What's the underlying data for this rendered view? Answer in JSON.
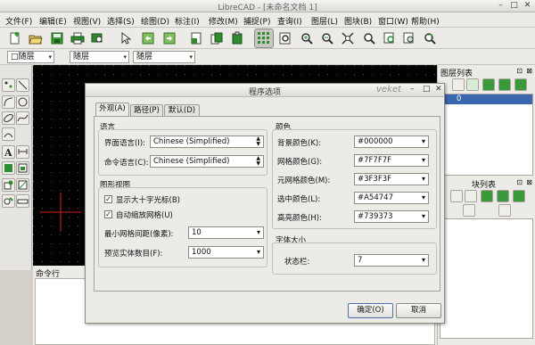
{
  "window": {
    "title": "LibreCAD - [未命名文档 1]"
  },
  "menus": [
    "文件(F)",
    "编辑(E)",
    "视图(V)",
    "选择(S)",
    "绘图(D)",
    "标注(I)",
    "修改(M)",
    "捕捉(P)",
    "查询(I)",
    "图层(L)",
    "图块(B)",
    "窗口(W)",
    "帮助(H)"
  ],
  "layerbar": {
    "combo1": "□随层",
    "combo2": "随层",
    "combo3": "随层"
  },
  "right_panel": {
    "layer_title": "图层列表",
    "layer_item": "0",
    "block_title": "块列表"
  },
  "cmd_panel": {
    "title": "命令行"
  },
  "dialog": {
    "title": "程序选项",
    "watermark": "veket",
    "tabs": [
      "外观(A)",
      "路径(P)",
      "默认(D)"
    ],
    "language_group": {
      "title": "语言",
      "ui_label": "界面语言(I):",
      "ui_value": "Chinese (Simplified)",
      "cmd_label": "命令语言(C):",
      "cmd_value": "Chinese (Simplified)"
    },
    "view_group": {
      "title": "图形视图",
      "crosshair_label": "显示大十字光标(B)",
      "autoscale_label": "自动缩放网格(U)",
      "min_grid_label": "最小网格间距(像素):",
      "min_grid_value": "10",
      "preview_label": "预览实体数目(F):",
      "preview_value": "1000"
    },
    "color_group": {
      "title": "颜色",
      "rows": [
        {
          "label": "背景颜色(K):",
          "value": "#000000"
        },
        {
          "label": "网格颜色(G):",
          "value": "#7F7F7F"
        },
        {
          "label": "元网格颜色(M):",
          "value": "#3F3F3F"
        },
        {
          "label": "选中颜色(L):",
          "value": "#A54747"
        },
        {
          "label": "高亮颜色(H):",
          "value": "#739373"
        }
      ]
    },
    "font_group": {
      "title": "字体大小",
      "status_label": "状态栏:",
      "status_value": "7"
    },
    "ok_label": "确定(O)",
    "cancel_label": "取消"
  }
}
